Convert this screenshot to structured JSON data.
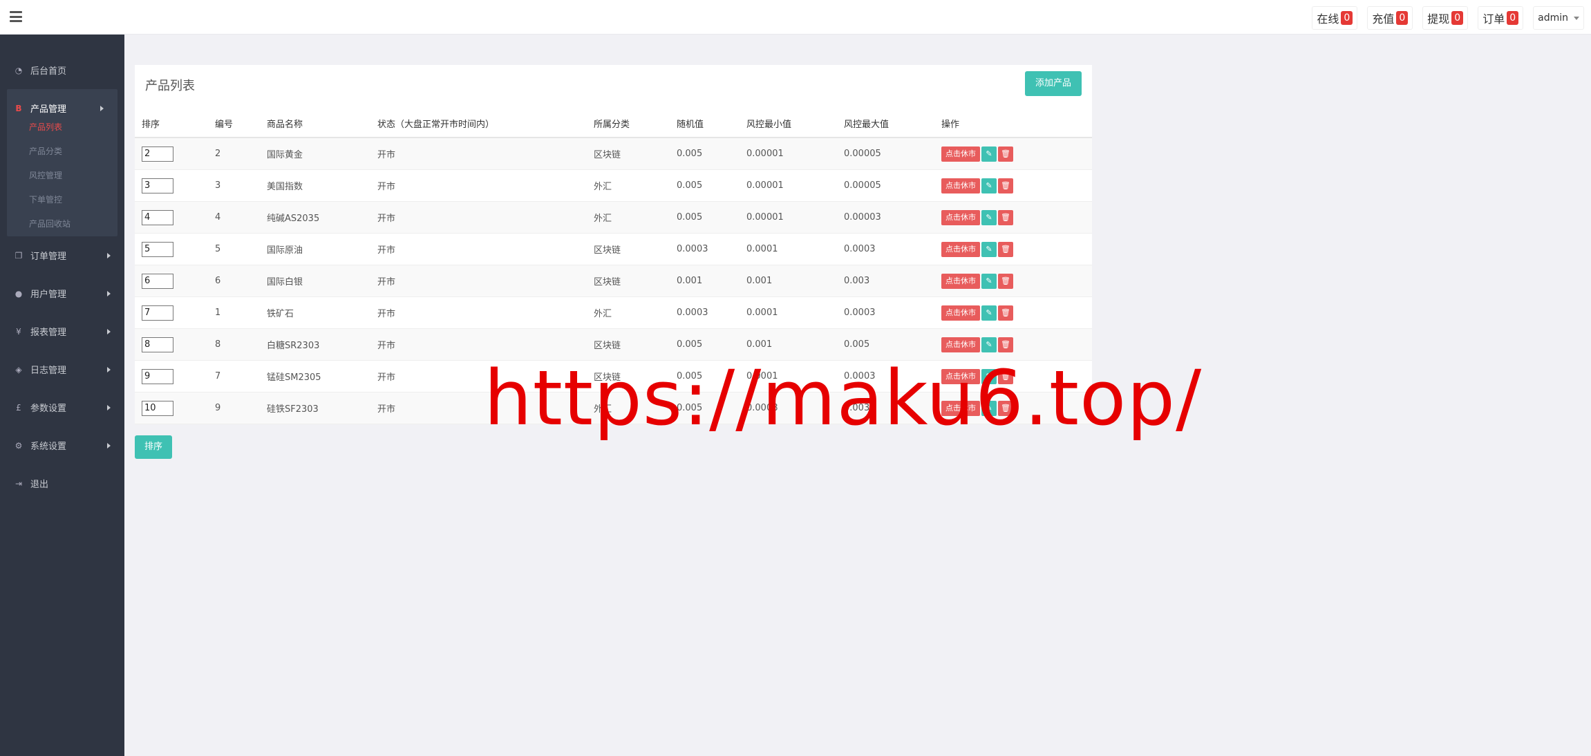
{
  "topbar": {
    "items": [
      {
        "label": "在线",
        "count": "0"
      },
      {
        "label": "充值",
        "count": "0"
      },
      {
        "label": "提现",
        "count": "0"
      },
      {
        "label": "订单",
        "count": "0"
      }
    ],
    "user": "admin"
  },
  "sidebar": {
    "home": "后台首页",
    "product_group": {
      "label": "产品管理",
      "subs": [
        "产品列表",
        "产品分类",
        "风控管理",
        "下单管控",
        "产品回收站"
      ]
    },
    "items": [
      "订单管理",
      "用户管理",
      "报表管理",
      "日志管理",
      "参数设置",
      "系统设置"
    ],
    "logout": "退出"
  },
  "panel": {
    "title": "产品列表",
    "add_label": "添加产品",
    "columns": [
      "排序",
      "编号",
      "商品名称",
      "状态（大盘正常开市时间内）",
      "所属分类",
      "随机值",
      "风控最小值",
      "风控最大值",
      "操作"
    ],
    "rows": [
      {
        "sort": "2",
        "id": "2",
        "name": "国际黄金",
        "status": "开市",
        "category": "区块链",
        "random": "0.005",
        "min": "0.00001",
        "max": "0.00005"
      },
      {
        "sort": "3",
        "id": "3",
        "name": "美国指数",
        "status": "开市",
        "category": "外汇",
        "random": "0.005",
        "min": "0.00001",
        "max": "0.00005"
      },
      {
        "sort": "4",
        "id": "4",
        "name": "纯碱AS2035",
        "status": "开市",
        "category": "外汇",
        "random": "0.005",
        "min": "0.00001",
        "max": "0.00003"
      },
      {
        "sort": "5",
        "id": "5",
        "name": "国际原油",
        "status": "开市",
        "category": "区块链",
        "random": "0.0003",
        "min": "0.0001",
        "max": "0.0003"
      },
      {
        "sort": "6",
        "id": "6",
        "name": "国际白银",
        "status": "开市",
        "category": "区块链",
        "random": "0.001",
        "min": "0.001",
        "max": "0.003"
      },
      {
        "sort": "7",
        "id": "1",
        "name": "铁矿石",
        "status": "开市",
        "category": "外汇",
        "random": "0.0003",
        "min": "0.0001",
        "max": "0.0003"
      },
      {
        "sort": "8",
        "id": "8",
        "name": "白糖SR2303",
        "status": "开市",
        "category": "区块链",
        "random": "0.005",
        "min": "0.001",
        "max": "0.005"
      },
      {
        "sort": "9",
        "id": "7",
        "name": "锰硅SM2305",
        "status": "开市",
        "category": "区块链",
        "random": "0.005",
        "min": "0.0001",
        "max": "0.0003"
      },
      {
        "sort": "10",
        "id": "9",
        "name": "硅铁SF2303",
        "status": "开市",
        "category": "外汇",
        "random": "0.005",
        "min": "0.0008",
        "max": "0.0030"
      }
    ],
    "rest_label": "点击休市"
  },
  "sort_button": "排序",
  "watermark": "https://maku6.top/",
  "colors": {
    "accent": "#3fc1b3",
    "danger": "#e85c5c",
    "sidebar": "#2f3542",
    "badge": "#e53935"
  }
}
